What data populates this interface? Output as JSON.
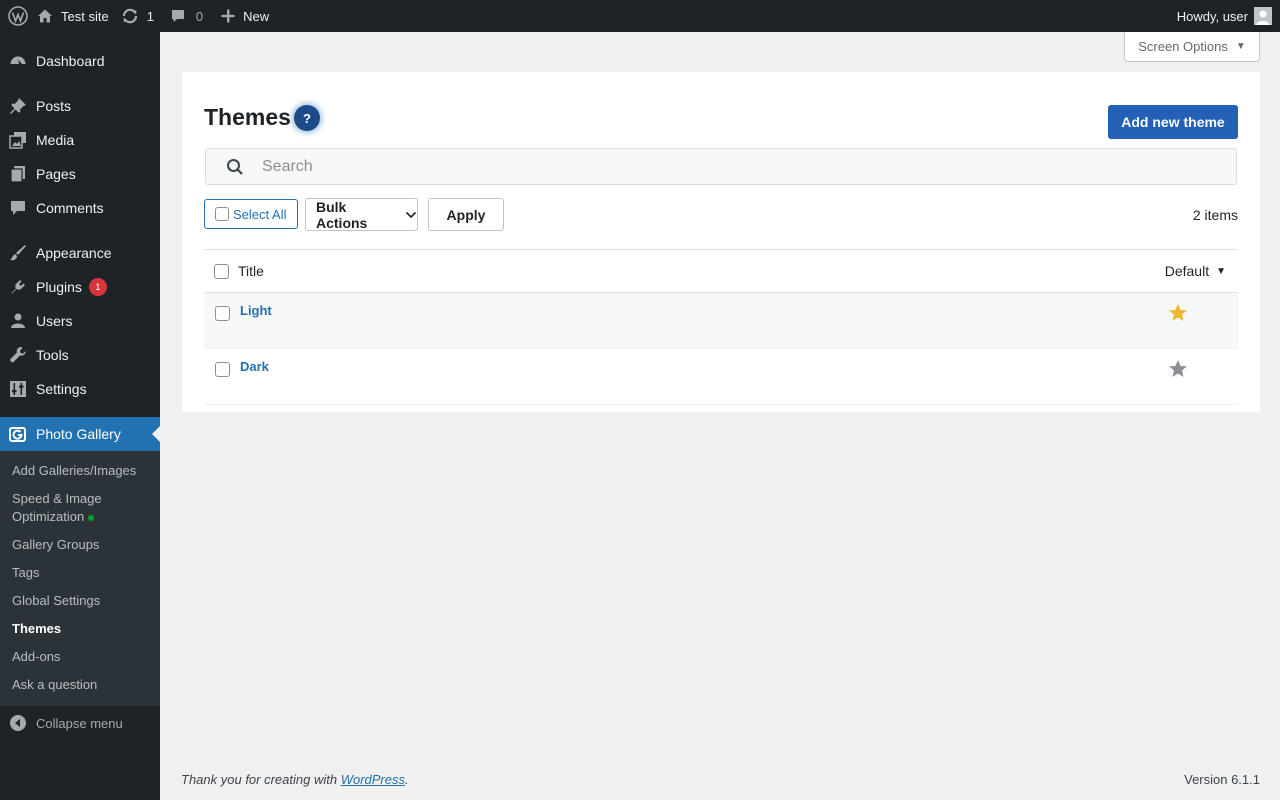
{
  "admin_bar": {
    "site_name": "Test site",
    "updates_count": "1",
    "comments_count": "0",
    "new_label": "New",
    "greeting": "Howdy, user"
  },
  "sidebar": {
    "items": [
      {
        "label": "Dashboard",
        "icon": "dashboard-icon"
      },
      {
        "label": "Posts",
        "icon": "pin-icon"
      },
      {
        "label": "Media",
        "icon": "media-icon"
      },
      {
        "label": "Pages",
        "icon": "pages-icon"
      },
      {
        "label": "Comments",
        "icon": "comment-icon"
      },
      {
        "label": "Appearance",
        "icon": "brush-icon"
      },
      {
        "label": "Plugins",
        "icon": "plug-icon",
        "badge": "1"
      },
      {
        "label": "Users",
        "icon": "user-icon"
      },
      {
        "label": "Tools",
        "icon": "wrench-icon"
      },
      {
        "label": "Settings",
        "icon": "settings-icon"
      },
      {
        "label": "Photo Gallery",
        "icon": "photo-gallery-icon"
      }
    ],
    "submenu": [
      {
        "label": "Add Galleries/Images"
      },
      {
        "label": "Speed & Image"
      },
      {
        "label": "Optimization"
      },
      {
        "label": "Gallery Groups"
      },
      {
        "label": "Tags"
      },
      {
        "label": "Global Settings"
      },
      {
        "label": "Themes"
      },
      {
        "label": "Add-ons"
      },
      {
        "label": "Ask a question"
      }
    ],
    "collapse_label": "Collapse menu"
  },
  "screen_options": {
    "label": "Screen Options"
  },
  "main": {
    "title": "Themes",
    "help_label": "?",
    "add_button": "Add new theme",
    "search_placeholder": "Search",
    "select_all": "Select All",
    "bulk_actions": "Bulk Actions",
    "apply": "Apply",
    "items_count": "2 items",
    "columns": {
      "title": "Title",
      "default": "Default"
    },
    "rows": [
      {
        "title": "Light",
        "is_default": true
      },
      {
        "title": "Dark",
        "is_default": false
      }
    ]
  },
  "colors": {
    "star_default": "#f0b831",
    "star_inactive": "#8c8f94",
    "accent": "#2271b1"
  },
  "footer": {
    "thanks_prefix": "Thank you for creating with ",
    "thanks_link": "WordPress",
    "thanks_suffix": ".",
    "version": "Version 6.1.1"
  }
}
